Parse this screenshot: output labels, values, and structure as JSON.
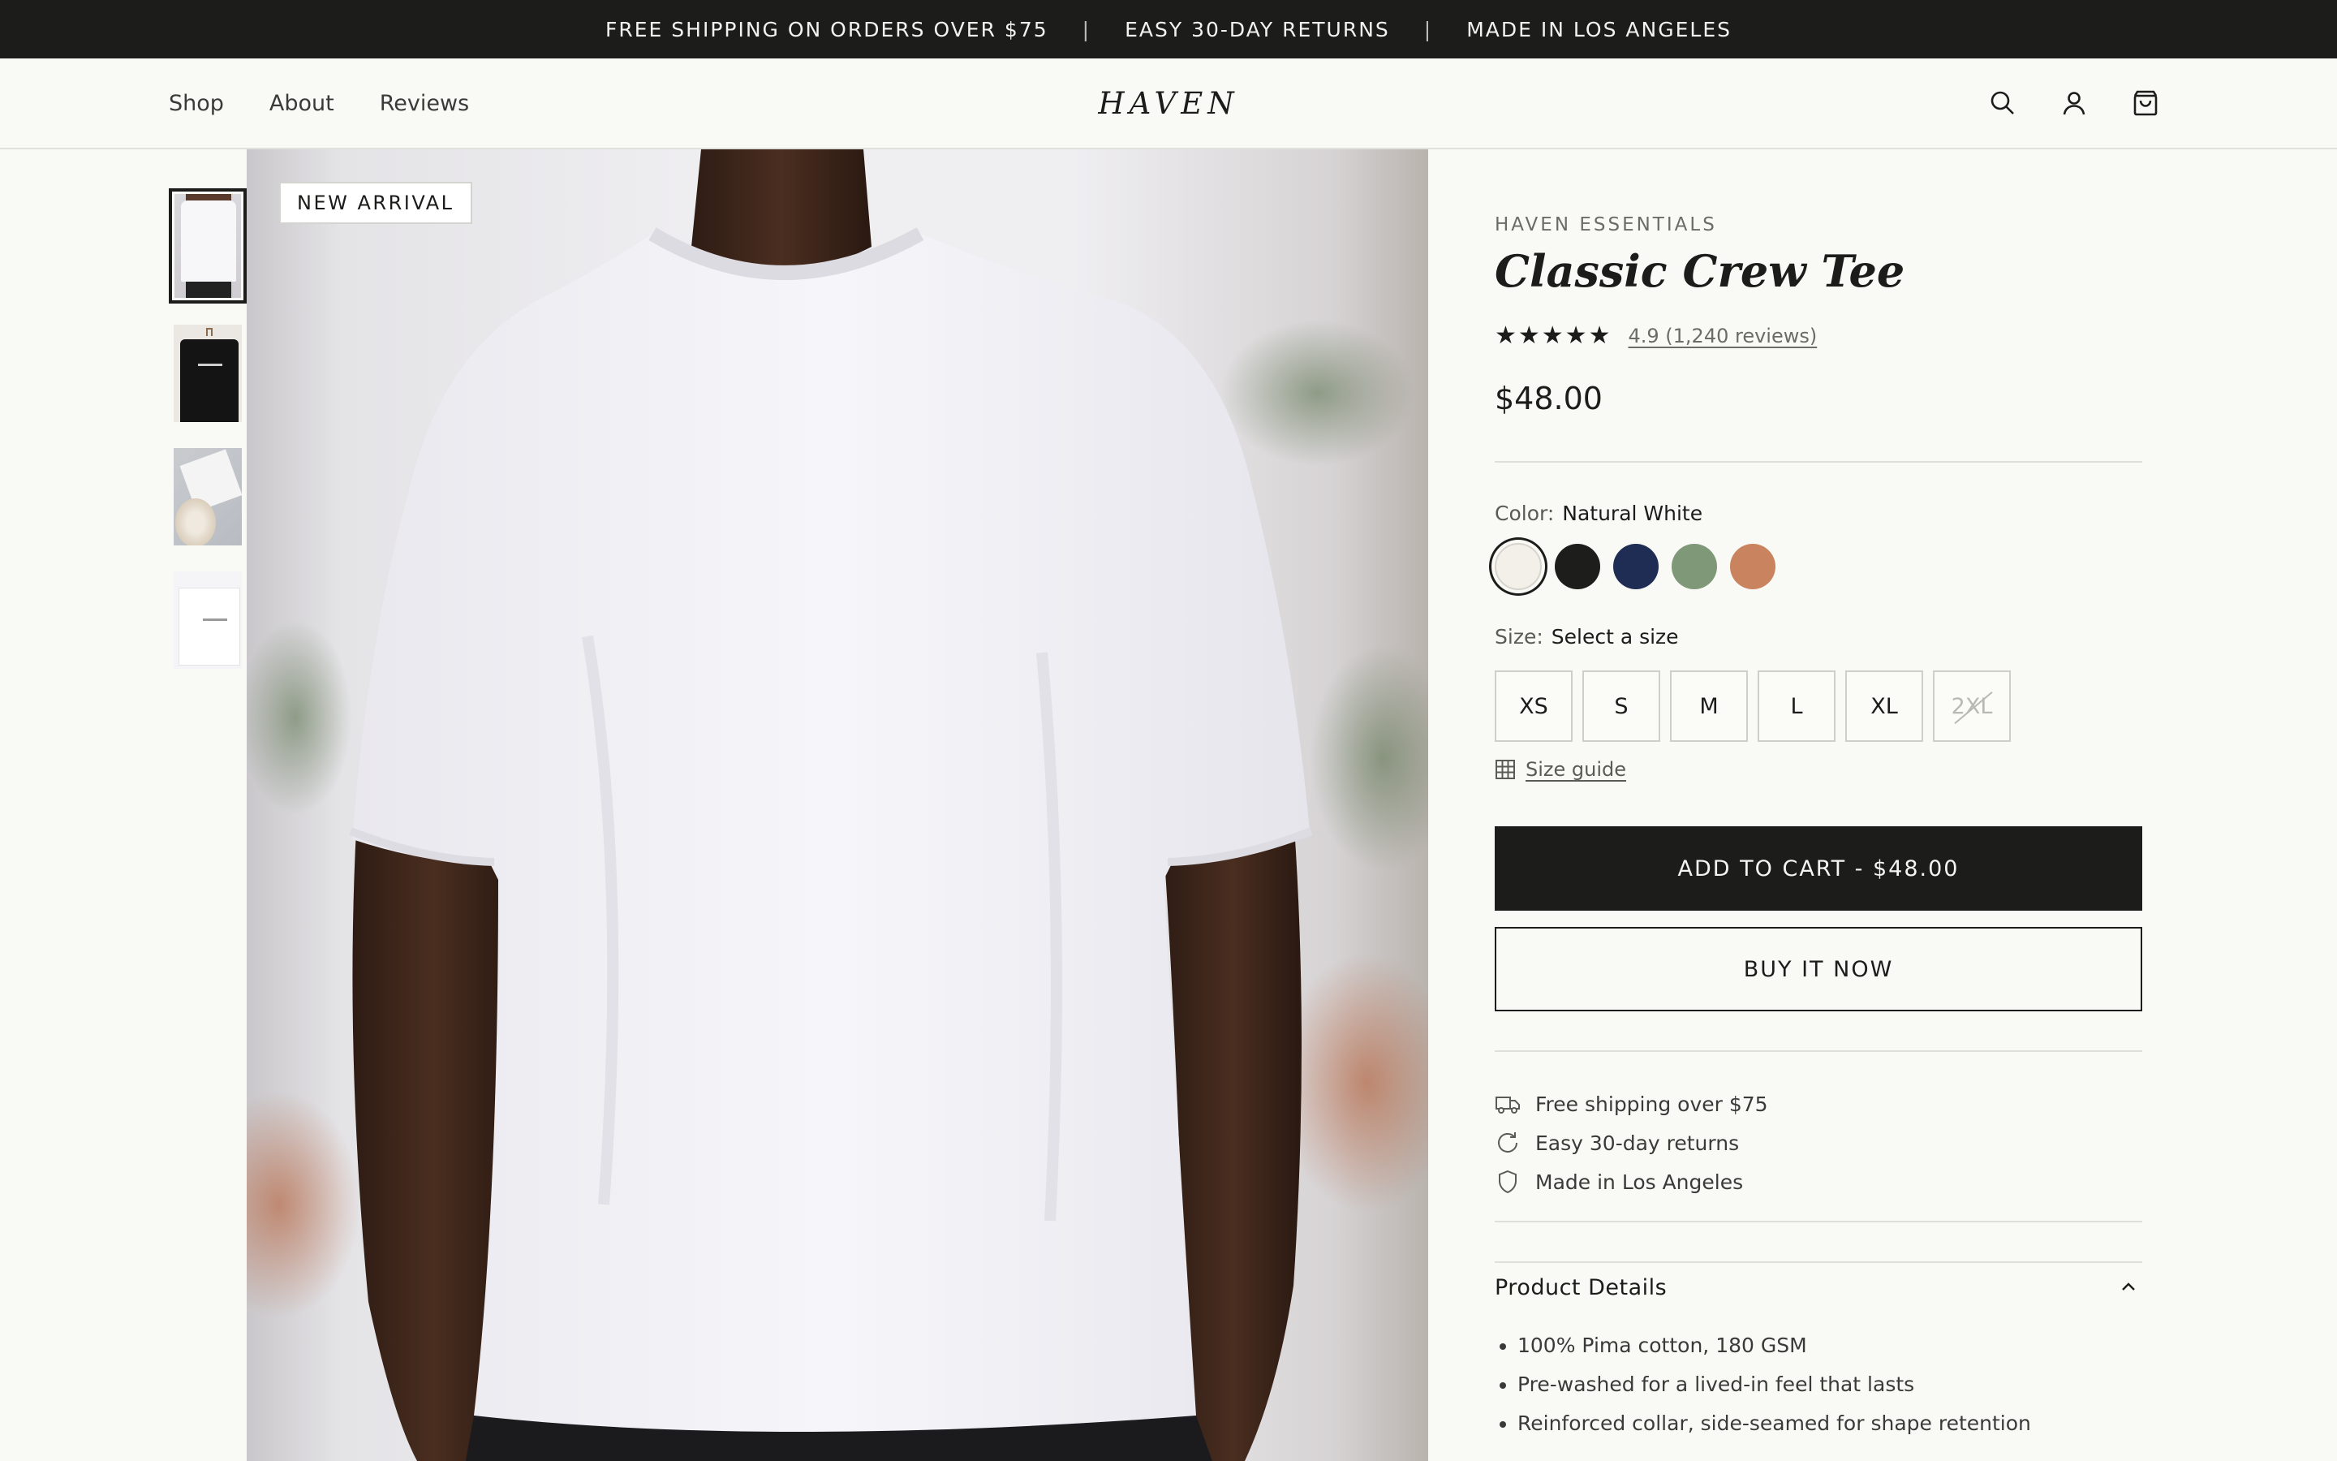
{
  "announcement": {
    "items": [
      "FREE SHIPPING ON ORDERS OVER $75",
      "EASY 30-DAY RETURNS",
      "MADE IN LOS ANGELES"
    ],
    "separator": "|"
  },
  "header": {
    "nav": [
      "Shop",
      "About",
      "Reviews"
    ],
    "logo": "HAVEN",
    "icons": [
      "search-icon",
      "account-icon",
      "cart-icon"
    ]
  },
  "gallery": {
    "thumbnails": [
      "white-tee-model",
      "black-tee-hanger",
      "folded-tee-packaging",
      "folded-white-tee"
    ],
    "active_index": 0,
    "badge": "NEW ARRIVAL"
  },
  "product": {
    "brand": "HAVEN ESSENTIALS",
    "title": "Classic Crew Tee",
    "stars": "★★★★★",
    "rating_text": "4.9 (1,240 reviews)",
    "price": "$48.00",
    "color_label": "Color:",
    "color_value": "Natural White",
    "colors": [
      {
        "name": "Natural White",
        "hex": "#f3f0ea",
        "selected": true
      },
      {
        "name": "Black",
        "hex": "#1d1d1b",
        "selected": false
      },
      {
        "name": "Navy",
        "hex": "#1f2d55",
        "selected": false
      },
      {
        "name": "Sage",
        "hex": "#7f9878",
        "selected": false
      },
      {
        "name": "Terracotta",
        "hex": "#c9835f",
        "selected": false
      }
    ],
    "size_label": "Size:",
    "size_value": "Select a size",
    "sizes": [
      "XS",
      "S",
      "M",
      "L",
      "XL",
      "2XL"
    ],
    "size_guide": "Size guide",
    "add_to_cart": "ADD TO CART - $48.00",
    "buy_now": "BUY IT NOW",
    "perks": [
      "Free shipping over $75",
      "Easy 30-day returns",
      "Made in Los Angeles"
    ],
    "details_heading": "Product Details",
    "details": [
      "100% Pima cotton, 180 GSM",
      "Pre-washed for a lived-in feel that lasts",
      "Reinforced collar, side-seamed for shape retention"
    ]
  }
}
